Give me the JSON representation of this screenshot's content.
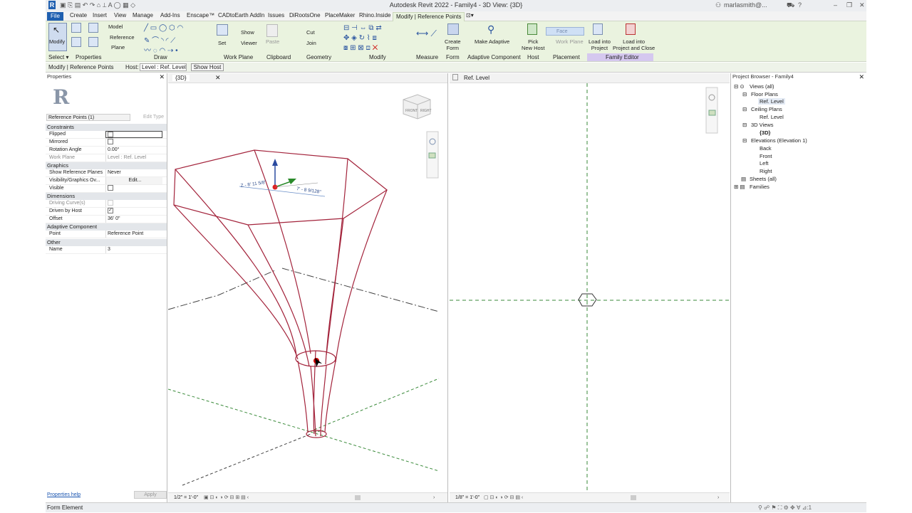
{
  "titlebar": {
    "title": "Autodesk Revit 2022 - Family4 - 3D View: {3D}",
    "user": "marlasmith@..."
  },
  "tabs": [
    "File",
    "Create",
    "Insert",
    "View",
    "Manage",
    "Add-Ins",
    "Enscape™",
    "CADtoEarth AddIn",
    "Issues",
    "DiRootsOne",
    "PlaceMaker",
    "Rhino.Inside",
    "Modify | Reference Points"
  ],
  "ribbon": {
    "panels": [
      "Select ▾",
      "Properties",
      "Draw",
      "Work Plane",
      "Clipboard",
      "Geometry",
      "Modify",
      "Measure",
      "Form",
      "Adaptive Component",
      "Host",
      "Placement",
      "Family Editor"
    ],
    "modify": "Modify",
    "model": "Model",
    "reference": "Reference",
    "plane": "Plane",
    "set": "Set",
    "show": "Show",
    "viewer": "Viewer",
    "paste": "Paste",
    "cut": "Cut",
    "join": "Join",
    "create_form": "Create\nForm",
    "make_adaptive": "Make Adaptive",
    "pick_new_host": "Pick\nNew Host",
    "face": "Face",
    "work_plane": "Work Plane",
    "load_into_project": "Load into\nProject",
    "load_close": "Load into\nProject and Close"
  },
  "optbar": {
    "context": "Modify | Reference Points",
    "host_label": "Host:",
    "host_value": "Level : Ref. Level",
    "show_host": "Show Host"
  },
  "properties": {
    "title": "Properties",
    "type_selector": "Reference Points (1)",
    "edit_type": "Edit Type",
    "groups": {
      "constraints": "Constraints",
      "graphics": "Graphics",
      "dimensions": "Dimensions",
      "adaptive": "Adaptive Component",
      "other": "Other"
    },
    "rows": {
      "flipped": "Flipped",
      "mirrored": "Mirrored",
      "rotation_angle": "Rotation Angle",
      "rotation_angle_val": "0.00°",
      "work_plane": "Work Plane",
      "work_plane_val": "Level : Ref. Level",
      "show_ref_planes": "Show Reference Planes",
      "show_ref_planes_val": "Never",
      "vis_graphics": "Visibility/Graphics Ov...",
      "vis_graphics_val": "Edit...",
      "visible": "Visible",
      "driving_curve": "Driving Curve(s)",
      "driven_by_host": "Driven by Host",
      "offset": "Offset",
      "offset_val": "36'  0\"",
      "point": "Point",
      "point_val": "Reference Point",
      "name": "Name",
      "name_val": "3"
    },
    "help": "Properties help",
    "apply": "Apply"
  },
  "view3d": {
    "tab": "{3D}",
    "scale": "1/2\" = 1'-0\"",
    "dim1": "Z - 8' 11 5/8\"",
    "dim2": "7' - 8 9/128\""
  },
  "viewplan": {
    "tab": "Ref. Level",
    "scale": "1/8\" = 1'-0\""
  },
  "browser": {
    "title": "Project Browser - Family4",
    "items": [
      "Views (all)",
      "Floor Plans",
      "Ref. Level",
      "Ceiling Plans",
      "Ref. Level",
      "3D Views",
      "{3D}",
      "Elevations (Elevation 1)",
      "Back",
      "Front",
      "Left",
      "Right",
      "Sheets (all)",
      "Families"
    ]
  },
  "status": {
    "text": "Form Element"
  },
  "colors": {
    "ribbon": "#eaf3df",
    "file_tab": "#1f5fb0",
    "form_line": "#a3233b",
    "green_dash": "#3a8a3a"
  }
}
